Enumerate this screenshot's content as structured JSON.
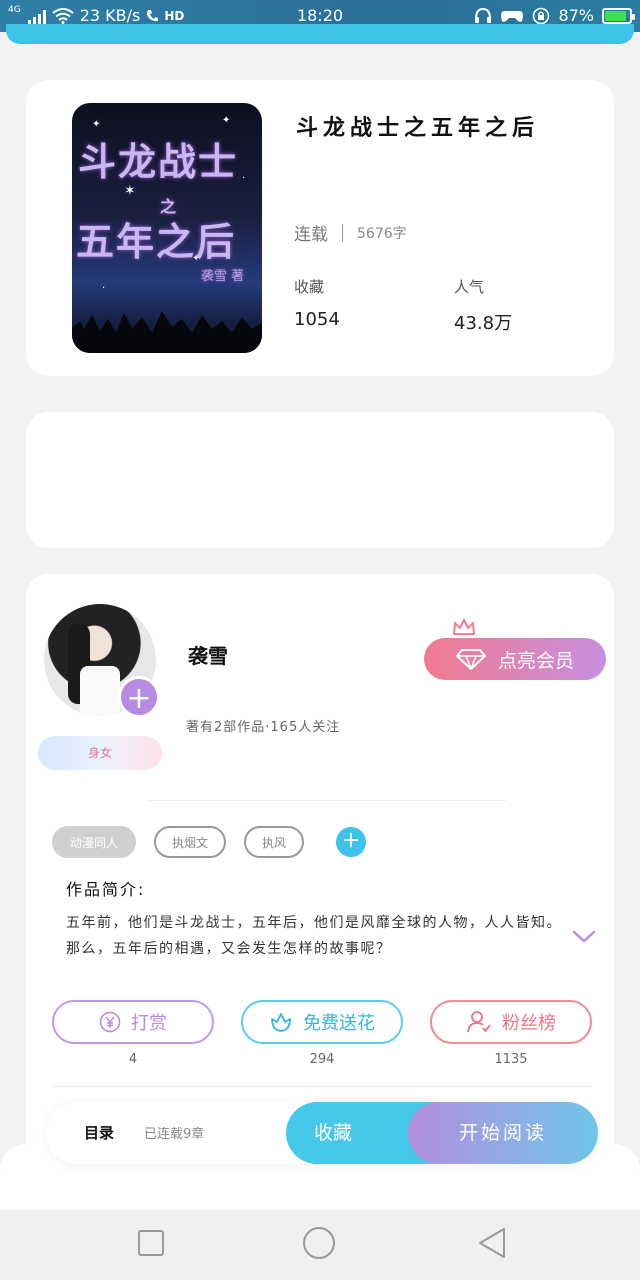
{
  "status_bar": {
    "network": "4G",
    "speed": "23 KB/s",
    "hd": "HD",
    "time": "18:20",
    "battery": "87%",
    "battery_level": 0.87
  },
  "book": {
    "cover_title_line1": "斗龙战士",
    "cover_title_mid": "之",
    "cover_title_line2": "五年之后",
    "cover_author": "袭雪 著",
    "title": "斗龙战士之五年之后",
    "status": "连载",
    "word_count": "5676字",
    "favorites_label": "收藏",
    "favorites_value": "1054",
    "popularity_label": "人气",
    "popularity_value": "43.8万"
  },
  "author": {
    "name": "袭雪",
    "summary": "著有2部作品·165人关注",
    "gender_tag": "身女",
    "vip_label": "点亮会员"
  },
  "tags": [
    "动漫同人",
    "执烟文",
    "执风"
  ],
  "intro": {
    "heading": "作品简介:",
    "text": "五年前，他们是斗龙战士，五年后，他们是风靡全球的人物，人人皆知。那么，五年后的相遇，又会发生怎样的故事呢？"
  },
  "actions": [
    {
      "label": "打赏",
      "count": "4"
    },
    {
      "label": "免费送花",
      "count": "294"
    },
    {
      "label": "粉丝榜",
      "count": "1135"
    }
  ],
  "read_bar": {
    "toc_label": "目录",
    "chapters_label": "已连载9章",
    "favorite_label": "收藏",
    "start_label": "开始阅读"
  },
  "colors": {
    "accent_blue": "#45c8ea",
    "accent_purple": "#b88be2",
    "accent_pink": "#ea7480"
  }
}
